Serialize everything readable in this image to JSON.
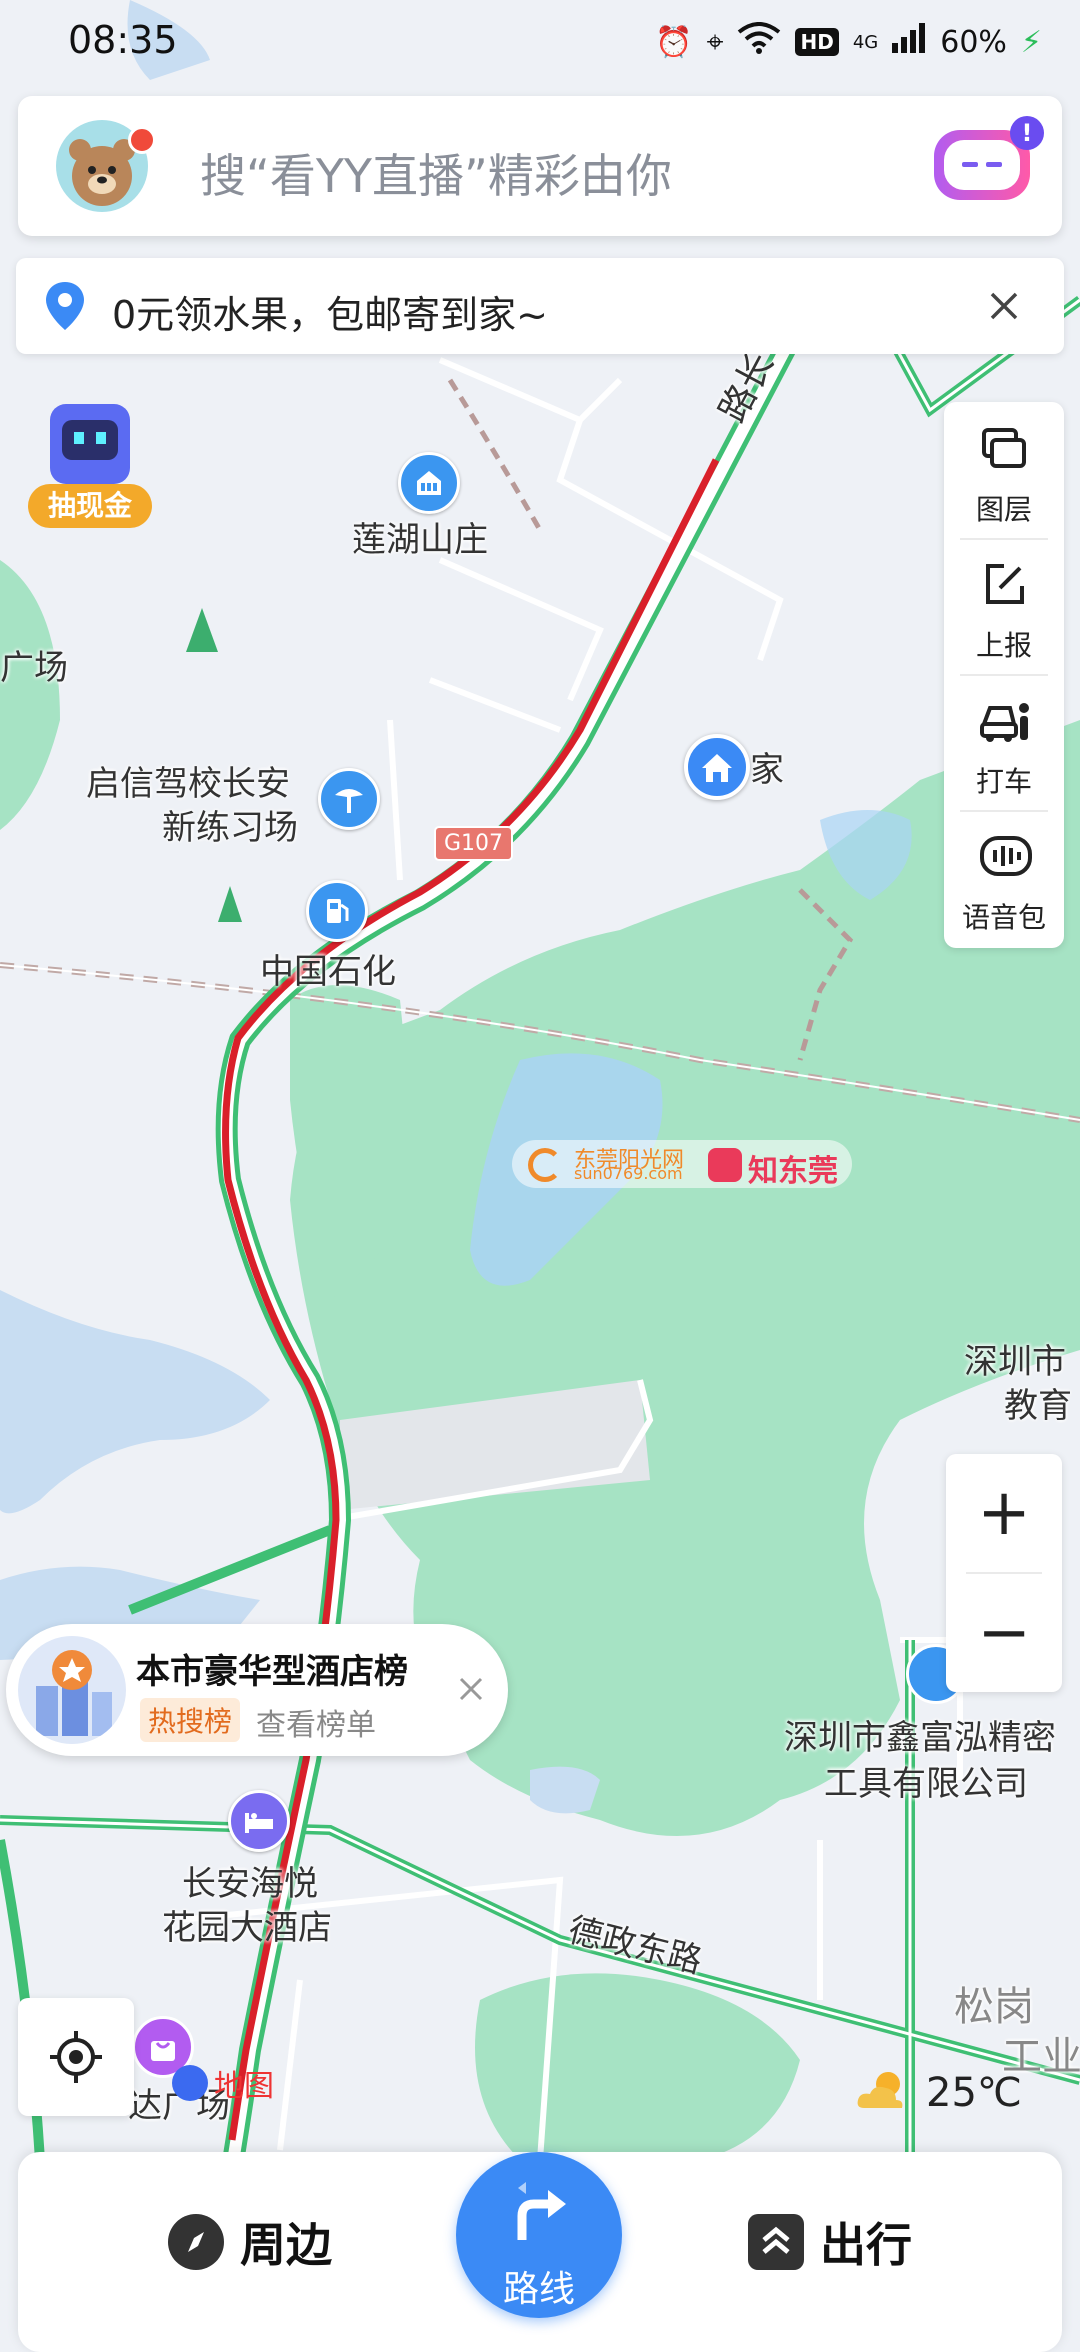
{
  "status_bar": {
    "time": "08:35",
    "network": "4G",
    "battery": "60%",
    "hd": "HD"
  },
  "search": {
    "placeholder": "搜“看YY直播”精彩由你",
    "assistant_badge": "!"
  },
  "promo": {
    "text": "0元领水果，包邮寄到家~"
  },
  "cashback": {
    "label": "抽现金"
  },
  "tools": [
    {
      "label": "图层",
      "icon": "layers-icon"
    },
    {
      "label": "上报",
      "icon": "report-edit-icon"
    },
    {
      "label": "打车",
      "icon": "taxi-icon"
    },
    {
      "label": "语音包",
      "icon": "voice-pack-icon"
    }
  ],
  "zoom": {
    "in": "+",
    "out": "−"
  },
  "map_labels": {
    "lianhu": "莲湖山庄",
    "driving_school_1": "启信驾校长安",
    "driving_school_2": "新练习场",
    "sinopec": "中国石化",
    "home": "家",
    "road_g107": "G107",
    "road_top": "路长",
    "square_left": "广场",
    "shenzhen_edu_1": "深圳市",
    "shenzhen_edu_2": "教育",
    "xinfuhong_1": "深圳市鑫富泓精密",
    "xinfuhong_2": "工具有限公司",
    "hotel_1": "长安海悦",
    "hotel_2": "花园大酒店",
    "dezheng_road": "德政东路",
    "songgang_1": "松岗",
    "songgang_2": "工业",
    "plaza_bottom": "达广场"
  },
  "watermark": {
    "text_1": "东莞阳光网",
    "text_2": "sun0769.com",
    "text_3": "知东莞"
  },
  "baidu_logo": "地图",
  "hotel_popup": {
    "title": "本市豪华型酒店榜",
    "tag": "热搜榜",
    "link": "查看榜单"
  },
  "weather": {
    "temperature": "25℃",
    "icon": "cloudy-sun-icon"
  },
  "bottom_nav": {
    "nearby": "周边",
    "route": "路线",
    "travel": "出行"
  },
  "colors": {
    "accent": "#3b8af5",
    "traffic_red": "#d9202a",
    "road_green": "#3fbf74",
    "park_green": "#a6e3c4"
  }
}
